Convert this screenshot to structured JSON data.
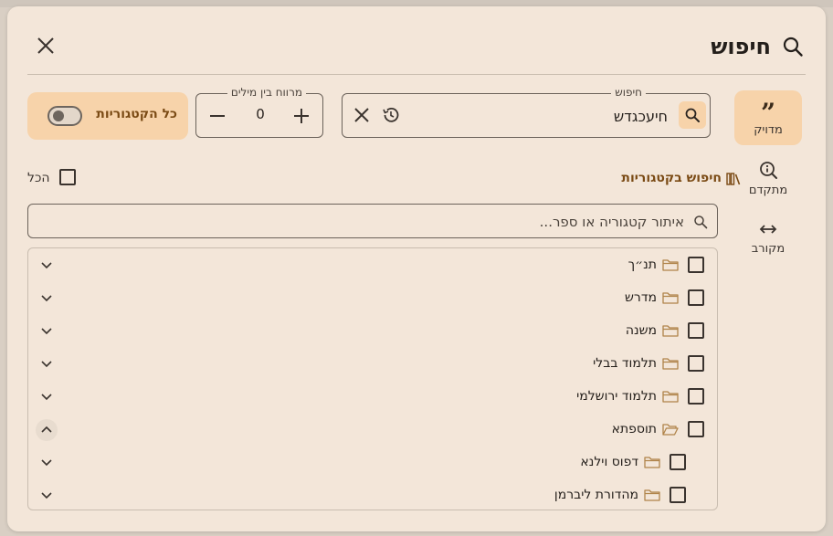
{
  "dialog": {
    "title": "חיפוש"
  },
  "nav": [
    {
      "key": "exact",
      "label": "מדויק"
    },
    {
      "key": "advanced",
      "label": "מתקדם"
    },
    {
      "key": "near",
      "label": "מקורב"
    }
  ],
  "search": {
    "label": "חיפוש",
    "value": "חיעכגדש"
  },
  "distance": {
    "label": "מרווח בין מילים",
    "value": "0"
  },
  "all_categories": {
    "label": "כל הקטגוריות",
    "enabled": false
  },
  "categories_section": {
    "title": "חיפוש בקטגוריות",
    "select_all_label": "הכל"
  },
  "filter": {
    "placeholder": "איתור קטגוריה או ספר..."
  },
  "tree": [
    {
      "label": "תנ״ך",
      "level": 0,
      "expanded": false
    },
    {
      "label": "מדרש",
      "level": 0,
      "expanded": false
    },
    {
      "label": "משנה",
      "level": 0,
      "expanded": false
    },
    {
      "label": "תלמוד בבלי",
      "level": 0,
      "expanded": false
    },
    {
      "label": "תלמוד ירושלמי",
      "level": 0,
      "expanded": false
    },
    {
      "label": "תוספתא",
      "level": 0,
      "expanded": true
    },
    {
      "label": "דפוס וילנא",
      "level": 1,
      "expanded": false
    },
    {
      "label": "מהדורת ליברמן",
      "level": 1,
      "expanded": false
    }
  ],
  "colors": {
    "background": "#f3e6d9",
    "accent": "#f7d3aa",
    "accent_text": "#7a4a14",
    "folder": "#b0844a"
  }
}
